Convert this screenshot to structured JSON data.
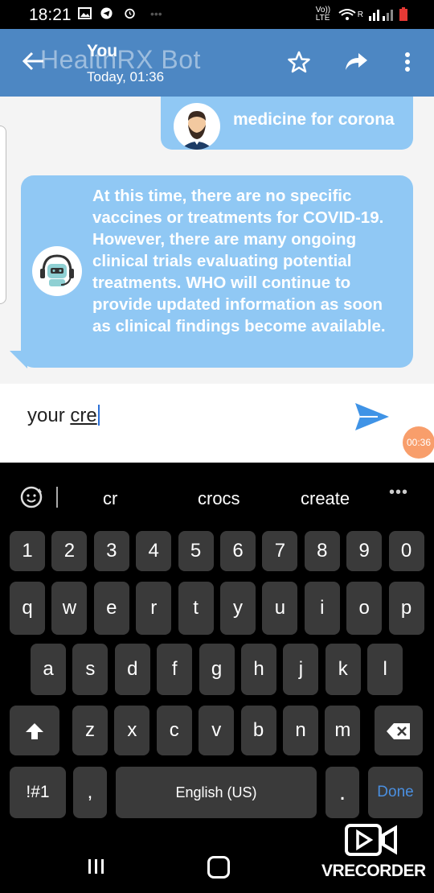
{
  "status": {
    "time": "18:21",
    "volte": "Vo)) LTE",
    "signal_r": "R"
  },
  "header": {
    "ghost_title": "HealthRX Bot",
    "title": "You",
    "subtitle": "Today, 01:36",
    "icons": [
      "back-arrow-icon",
      "star-icon",
      "share-icon",
      "more-vert-icon"
    ]
  },
  "chat": {
    "user_message": "medicine for corona",
    "bot_message": "At this time, there are no specific vaccines or treatments for COVID-19. However, there are many ongoing clinical trials evaluating potential treatments. WHO will continue to provide updated information as soon as clinical findings become available."
  },
  "composer": {
    "text_prefix": "your ",
    "text_underlined": "cre",
    "recording_timer": "00:36"
  },
  "keyboard": {
    "suggestions": [
      "cr",
      "crocs",
      "create"
    ],
    "more": "•••",
    "number_row": [
      "1",
      "2",
      "3",
      "4",
      "5",
      "6",
      "7",
      "8",
      "9",
      "0"
    ],
    "row1": [
      "q",
      "w",
      "e",
      "r",
      "t",
      "y",
      "u",
      "i",
      "o",
      "p"
    ],
    "row2": [
      "a",
      "s",
      "d",
      "f",
      "g",
      "h",
      "j",
      "k",
      "l"
    ],
    "row3": [
      "z",
      "x",
      "c",
      "v",
      "b",
      "n",
      "m"
    ],
    "symbols_key": "!#1",
    "comma_key": ",",
    "space_key": "English (US)",
    "period_key": ".",
    "done_key": "Done"
  },
  "overlay": {
    "recorder_label": "VRECORDER"
  },
  "colors": {
    "appbar": "#4d87c3",
    "bubble": "#90c8f4",
    "send": "#3f93e6",
    "done": "#4a8fe0"
  }
}
